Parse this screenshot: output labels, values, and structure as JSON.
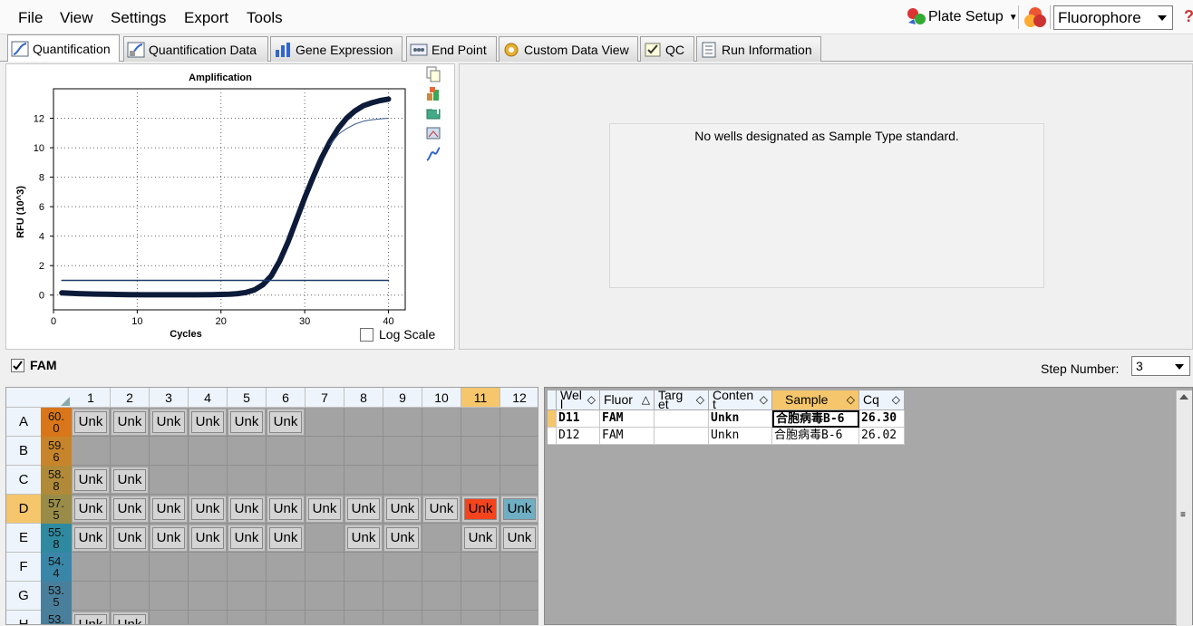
{
  "menu": {
    "file": "File",
    "view": "View",
    "settings": "Settings",
    "export": "Export",
    "tools": "Tools"
  },
  "toolbar": {
    "plate_setup": "Plate Setup",
    "fluorophore": "Fluorophore"
  },
  "tabs": [
    {
      "label": "Quantification"
    },
    {
      "label": "Quantification Data"
    },
    {
      "label": "Gene Expression"
    },
    {
      "label": "End Point"
    },
    {
      "label": "Custom Data View"
    },
    {
      "label": "QC"
    },
    {
      "label": "Run Information"
    }
  ],
  "chart_data": {
    "type": "line",
    "title": "Amplification",
    "xlabel": "Cycles",
    "ylabel": "RFU (10^3)",
    "xlim": [
      0,
      42
    ],
    "ylim": [
      -1,
      14
    ],
    "xticks": [
      0,
      10,
      20,
      30,
      40
    ],
    "yticks": [
      0,
      2,
      4,
      6,
      8,
      10,
      12
    ],
    "grid": true,
    "series": [
      {
        "color": "#0d1b3a",
        "width": 6,
        "x": [
          1,
          3,
          5,
          7,
          9,
          11,
          13,
          15,
          17,
          19,
          21,
          22,
          23,
          24,
          25,
          26,
          27,
          28,
          29,
          30,
          31,
          32,
          33,
          34,
          35,
          36,
          37,
          38,
          39,
          40
        ],
        "y": [
          0.15,
          0.1,
          0.07,
          0.05,
          0.03,
          0.02,
          0.02,
          0.02,
          0.02,
          0.03,
          0.06,
          0.1,
          0.18,
          0.35,
          0.7,
          1.3,
          2.3,
          3.6,
          5.1,
          6.6,
          8.0,
          9.3,
          10.4,
          11.3,
          12.0,
          12.5,
          12.85,
          13.05,
          13.2,
          13.3
        ]
      },
      {
        "color": "#3a5a8a",
        "width": 1,
        "x": [
          33,
          34,
          35,
          36,
          37,
          38,
          39,
          40
        ],
        "y": [
          10.2,
          10.9,
          11.3,
          11.6,
          11.8,
          11.9,
          11.95,
          12.0
        ]
      },
      {
        "color": "#1c3a6a",
        "width": 1.5,
        "x": [
          1,
          40
        ],
        "y": [
          1.0,
          1.0
        ]
      }
    ]
  },
  "log_scale_label": "Log Scale",
  "std_message": "No wells designated as Sample Type standard.",
  "fam_label": "FAM",
  "step_label": "Step Number:",
  "step_value": "3",
  "plate": {
    "cols": [
      "1",
      "2",
      "3",
      "4",
      "5",
      "6",
      "7",
      "8",
      "9",
      "10",
      "11",
      "12"
    ],
    "rows": [
      {
        "label": "A",
        "temp": "60.\n0",
        "wells": [
          "Unk",
          "Unk",
          "Unk",
          "Unk",
          "Unk",
          "Unk",
          "",
          "",
          "",
          "",
          "",
          ""
        ]
      },
      {
        "label": "B",
        "temp": "59.\n6",
        "wells": [
          "",
          "",
          "",
          "",
          "",
          "",
          "",
          "",
          "",
          "",
          "",
          ""
        ]
      },
      {
        "label": "C",
        "temp": "58.\n8",
        "wells": [
          "Unk",
          "Unk",
          "",
          "",
          "",
          "",
          "",
          "",
          "",
          "",
          "",
          ""
        ]
      },
      {
        "label": "D",
        "temp": "57.\n5",
        "wells": [
          "Unk",
          "Unk",
          "Unk",
          "Unk",
          "Unk",
          "Unk",
          "Unk",
          "Unk",
          "Unk",
          "Unk",
          "Unk",
          "Unk"
        ]
      },
      {
        "label": "E",
        "temp": "55.\n8",
        "wells": [
          "Unk",
          "Unk",
          "Unk",
          "Unk",
          "Unk",
          "Unk",
          "",
          "Unk",
          "Unk",
          "",
          "Unk",
          "Unk"
        ]
      },
      {
        "label": "F",
        "temp": "54.\n4",
        "wells": [
          "",
          "",
          "",
          "",
          "",
          "",
          "",
          "",
          "",
          "",
          "",
          ""
        ]
      },
      {
        "label": "G",
        "temp": "53.\n5",
        "wells": [
          "",
          "",
          "",
          "",
          "",
          "",
          "",
          "",
          "",
          "",
          "",
          ""
        ]
      },
      {
        "label": "H",
        "temp": "53.",
        "wells": [
          "Unk",
          "Unk",
          "",
          "",
          "",
          "",
          "",
          "",
          "",
          "",
          "",
          ""
        ]
      }
    ],
    "selected_row": "D",
    "selected_col": "11",
    "highlight": {
      "red": "#f4441c",
      "blue": "#6fafc3",
      "header_sel": "#f5c66b"
    }
  },
  "results": {
    "headers": [
      "Wel\nl",
      "Fluor",
      "Targ\net",
      "Conten\nt",
      "Sample",
      "Cq"
    ],
    "rows": [
      [
        "D11",
        "FAM",
        "",
        "Unkn",
        "合胞病毒B-6",
        "26.30"
      ],
      [
        "D12",
        "FAM",
        "",
        "Unkn",
        "合胞病毒B-6",
        "26.02"
      ]
    ]
  }
}
